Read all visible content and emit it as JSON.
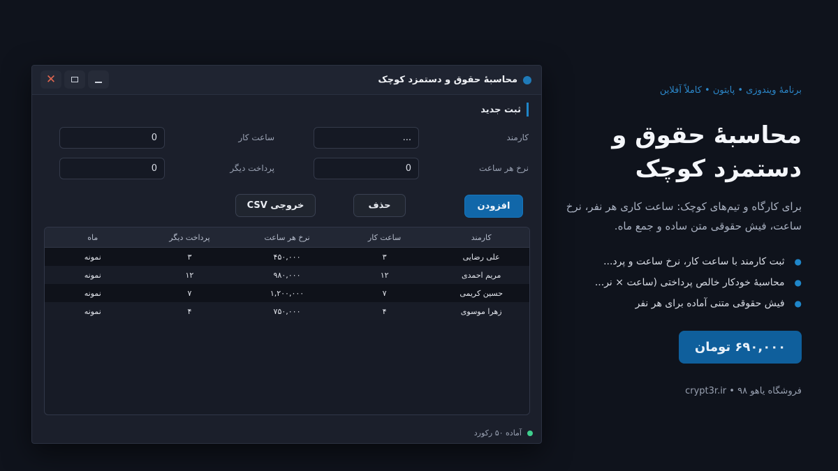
{
  "window": {
    "title": "محاسبهٔ حقوق و دستمزد کوچک",
    "close_glyph": "✕",
    "accent": "#1f7ab8"
  },
  "form": {
    "section_title": "ثبت جدید",
    "employee_label": "کارمند",
    "employee_value": "...",
    "hours_label": "ساعت کار",
    "hours_value": "0",
    "rate_label": "نرخ هر ساعت",
    "rate_value": "0",
    "other_label": "پرداخت دیگر",
    "other_value": "0"
  },
  "buttons": {
    "add": "افزودن",
    "delete": "حذف",
    "export": "خروجی CSV"
  },
  "table": {
    "headers": [
      "کارمند",
      "ساعت کار",
      "نرخ هر ساعت",
      "پرداخت دیگر",
      "ماه"
    ],
    "rows": [
      [
        "علی رضایی",
        "۳",
        "۴۵۰,۰۰۰",
        "۳",
        "نمونه"
      ],
      [
        "مریم احمدی",
        "۱۲",
        "۹۸۰,۰۰۰",
        "۱۲",
        "نمونه"
      ],
      [
        "حسین کریمی",
        "۷",
        "۱,۲۰۰,۰۰۰",
        "۷",
        "نمونه"
      ],
      [
        "زهرا موسوی",
        "۴",
        "۷۵۰,۰۰۰",
        "۴",
        "نمونه"
      ]
    ]
  },
  "status": {
    "text": "آماده ۵۰ رکورد",
    "color": "#3fcf8e"
  },
  "promo": {
    "tagline": "برنامهٔ ویندوزی • پایتون • کاملاً آفلاین",
    "headline_1": "محاسبهٔ حقوق و",
    "headline_2": "دستمزد کوچک",
    "description": "برای کارگاه و تیم‌های کوچک: ساعت کاری هر نفر، نرخ ساعت، فیش حقوقی متن ساده و جمع ماه.",
    "features": [
      "ثبت کارمند با ساعت کار، نرخ ساعت و پرد...",
      "محاسبهٔ خودکار خالص پرداختی (ساعت × نر...",
      "فیش حقوقی متنی آماده برای هر نفر"
    ],
    "price": "۶۹۰,۰۰۰ تومان",
    "footer": "فروشگاه یاهو ۹۸ • crypt3r.ir"
  }
}
